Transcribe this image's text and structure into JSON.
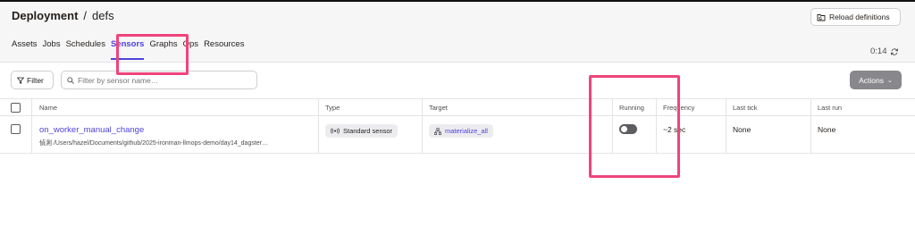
{
  "header": {
    "breadcrumb_root": "Deployment",
    "breadcrumb_separator": "/",
    "breadcrumb_location": "defs",
    "reload_label": "Reload definitions"
  },
  "tabs": [
    {
      "label": "Assets",
      "active": false
    },
    {
      "label": "Jobs",
      "active": false
    },
    {
      "label": "Schedules",
      "active": false
    },
    {
      "label": "Sensors",
      "active": true
    },
    {
      "label": "Graphs",
      "active": false
    },
    {
      "label": "Ops",
      "active": false
    },
    {
      "label": "Resources",
      "active": false
    }
  ],
  "refresh": {
    "countdown": "0:14",
    "icon": "refresh-icon"
  },
  "toolbar": {
    "filter_label": "Filter",
    "search_placeholder": "Filter by sensor name…",
    "actions_label": "Actions"
  },
  "table": {
    "columns": [
      "Name",
      "Type",
      "Target",
      "Running",
      "Frequency",
      "Last tick",
      "Last run"
    ],
    "rows": [
      {
        "name": "on_worker_manual_change",
        "path": "偵測 /Users/hazel/Documents/github/2025-ironman-llmops-demo/day14_dagster…",
        "type": "Standard sensor",
        "target": "materialize_all",
        "running": false,
        "frequency": "~2 sec",
        "last_tick": "None",
        "last_run": "None"
      }
    ]
  },
  "colors": {
    "accent": "#4f43dd",
    "highlight": "#f0447b",
    "header_bg": "#f6f6f7",
    "actions_bg": "#88888c"
  }
}
